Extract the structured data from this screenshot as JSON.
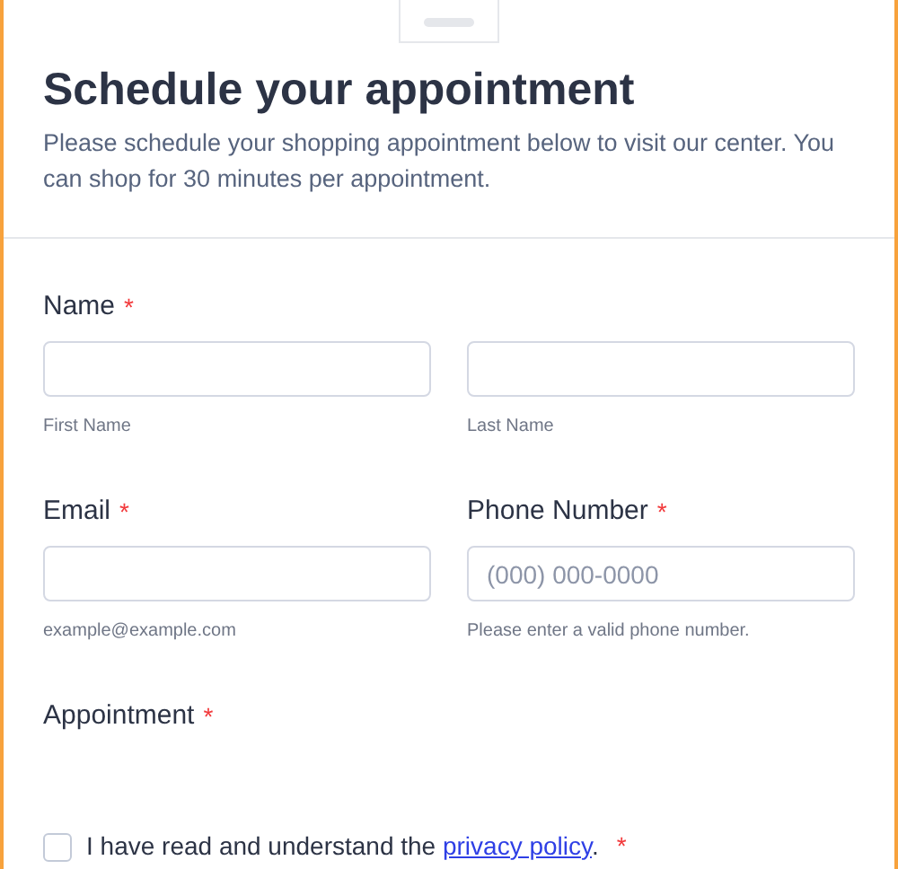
{
  "header": {
    "title": "Schedule your appointment",
    "description": "Please schedule your shopping appointment below to visit our center. You can shop for 30 minutes per appointment."
  },
  "rows": [
    {
      "label": "Name",
      "required_mark": "*",
      "fields": [
        {
          "sublabel": "First Name"
        },
        {
          "sublabel": "Last Name"
        }
      ]
    },
    {
      "fields": [
        {
          "label": "Email",
          "required_mark": "*",
          "sublabel": "example@example.com"
        },
        {
          "label": "Phone Number",
          "required_mark": "*",
          "placeholder": "(000) 000-0000",
          "sublabel": "Please enter a valid phone number."
        }
      ]
    }
  ],
  "appointment": {
    "label": "Appointment",
    "required_mark": "*"
  },
  "consent": {
    "checked": false,
    "text_before": "I have read and understand the ",
    "link": "privacy policy",
    "text_after": ".",
    "required_mark": "*"
  }
}
